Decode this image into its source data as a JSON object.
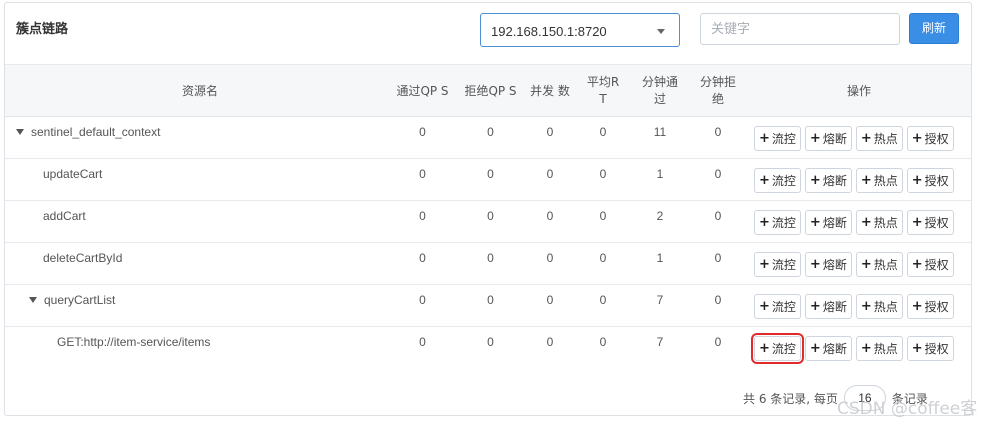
{
  "header": {
    "title": "簇点链路",
    "machine_value": "192.168.150.1:8720",
    "search_placeholder": "关键字",
    "refresh_label": "刷新"
  },
  "columns": {
    "resource": "资源名",
    "pass_qps": "通过QP S",
    "block_qps": "拒绝QP S",
    "concurrency": "并发 数",
    "avg_rt": "平均R T",
    "minute_pass": "分钟通 过",
    "minute_block": "分钟拒 绝",
    "ops": "操作"
  },
  "rows": [
    {
      "name": "sentinel_default_context",
      "expanded": true,
      "pass_qps": "0",
      "block_qps": "0",
      "concurrency": "0",
      "avg_rt": "0",
      "minute_pass": "11",
      "minute_block": "0"
    },
    {
      "name": "updateCart",
      "pass_qps": "0",
      "block_qps": "0",
      "concurrency": "0",
      "avg_rt": "0",
      "minute_pass": "1",
      "minute_block": "0"
    },
    {
      "name": "addCart",
      "pass_qps": "0",
      "block_qps": "0",
      "concurrency": "0",
      "avg_rt": "0",
      "minute_pass": "2",
      "minute_block": "0"
    },
    {
      "name": "deleteCartById",
      "pass_qps": "0",
      "block_qps": "0",
      "concurrency": "0",
      "avg_rt": "0",
      "minute_pass": "1",
      "minute_block": "0"
    },
    {
      "name": "queryCartList",
      "expanded": true,
      "pass_qps": "0",
      "block_qps": "0",
      "concurrency": "0",
      "avg_rt": "0",
      "minute_pass": "7",
      "minute_block": "0"
    },
    {
      "name": "GET:http://item-service/items",
      "pass_qps": "0",
      "block_qps": "0",
      "concurrency": "0",
      "avg_rt": "0",
      "minute_pass": "7",
      "minute_block": "0"
    }
  ],
  "ops": {
    "flow": "流控",
    "degrade": "熔断",
    "hotspot": "热点",
    "auth": "授权"
  },
  "pager": {
    "total_text": "共 6 条记录, 每页",
    "page_size": "16",
    "suffix": "条记录"
  },
  "watermark": "CSDN @coffee客"
}
